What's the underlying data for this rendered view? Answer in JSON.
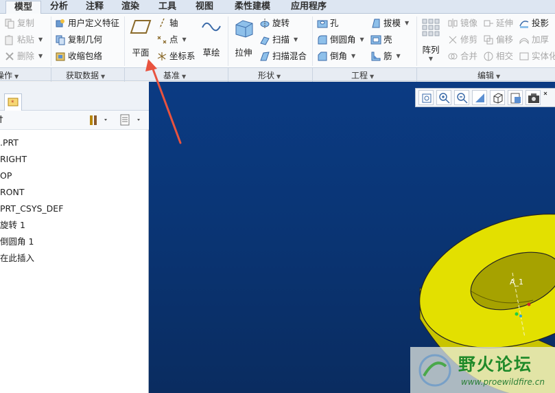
{
  "tabs": [
    "模型",
    "分析",
    "注释",
    "渲染",
    "工具",
    "视图",
    "柔性建模",
    "应用程序"
  ],
  "ribbon": {
    "operations": {
      "copy": "复制",
      "paste": "粘贴",
      "delete": "删除",
      "group_label": "操作"
    },
    "get_data": {
      "udf": "用户定义特征",
      "copy_geom": "复制几何",
      "shrinkwrap": "收缩包络",
      "group_label": "获取数据"
    },
    "datum": {
      "plane": "平面",
      "axis": "轴",
      "point": "点",
      "csys": "坐标系",
      "sketch": "草绘",
      "group_label": "基准"
    },
    "shapes": {
      "extrude": "拉伸",
      "revolve": "旋转",
      "sweep": "扫描",
      "swept_blend": "扫描混合",
      "group_label": "形状"
    },
    "engineering": {
      "hole": "孔",
      "round": "倒圆角",
      "chamfer": "倒角",
      "draft": "拔模",
      "shell": "壳",
      "rib": "筋",
      "group_label": "工程"
    },
    "editing": {
      "pattern": "阵列",
      "mirror": "镜像",
      "trim": "修剪",
      "merge": "合并",
      "extend": "延伸",
      "offset": "偏移",
      "intersect": "相交",
      "project": "投影",
      "thicken": "加厚",
      "solidify": "实体化",
      "group_label": "编辑"
    }
  },
  "model_tree": {
    "items": [
      ".PRT",
      "RIGHT",
      "OP",
      "RONT",
      "PRT_CSYS_DEF",
      "旋转 1",
      "倒圆角 1",
      "在此插入"
    ],
    "header_fragment": "†"
  },
  "viewport": {
    "axis_label": "A_1",
    "part_color": "#e3e000",
    "background_top": "#0b3b83",
    "background_bottom": "#0a2c60"
  },
  "watermark": {
    "title": "野火论坛",
    "url": "www.proewildfire.cn"
  },
  "annotation": {
    "arrow_color": "#e8533f"
  },
  "icons": {
    "copy": "copy-icon",
    "paste": "paste-icon",
    "delete": "delete-icon",
    "plane": "plane-icon",
    "axis": "axis-icon",
    "point": "point-icon",
    "csys": "csys-icon",
    "sketch": "sketch-icon",
    "extrude": "extrude-icon",
    "pattern": "pattern-icon"
  }
}
